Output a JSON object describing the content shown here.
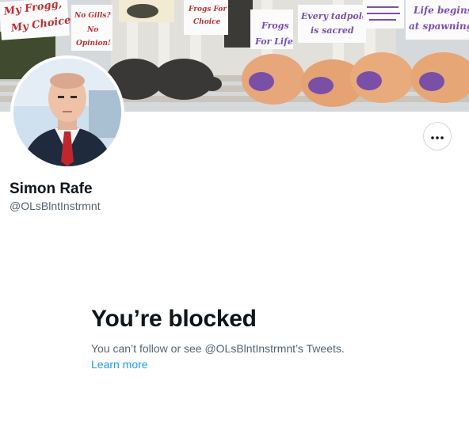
{
  "banner": {
    "signs": {
      "s1_line1": "My Frogg,",
      "s1_line2": "My Choice",
      "s2_line1": "No Gills?",
      "s2_line2": "No",
      "s2_line3": "Opinion!",
      "s3_line1": "Frogs For",
      "s3_line2": "Choice",
      "s4_line1": "Frogs",
      "s4_line2": "For Life",
      "s5_line1": "Every tadpole",
      "s5_line2": "is sacred",
      "s7_line1": "Life begins",
      "s7_line2": "at spawning"
    }
  },
  "profile": {
    "name": "Simon Rafe",
    "handle": "@OLsBlntInstrmnt"
  },
  "more_button": {
    "icon": "more-horizontal-icon"
  },
  "blocked": {
    "title": "You’re blocked",
    "description": "You can’t follow or see @OLsBlntInstrmnt’s Tweets.",
    "learn_more": "Learn more"
  },
  "colors": {
    "link": "#1d9bf0",
    "text_primary": "#0f1419",
    "text_secondary": "#536471"
  }
}
